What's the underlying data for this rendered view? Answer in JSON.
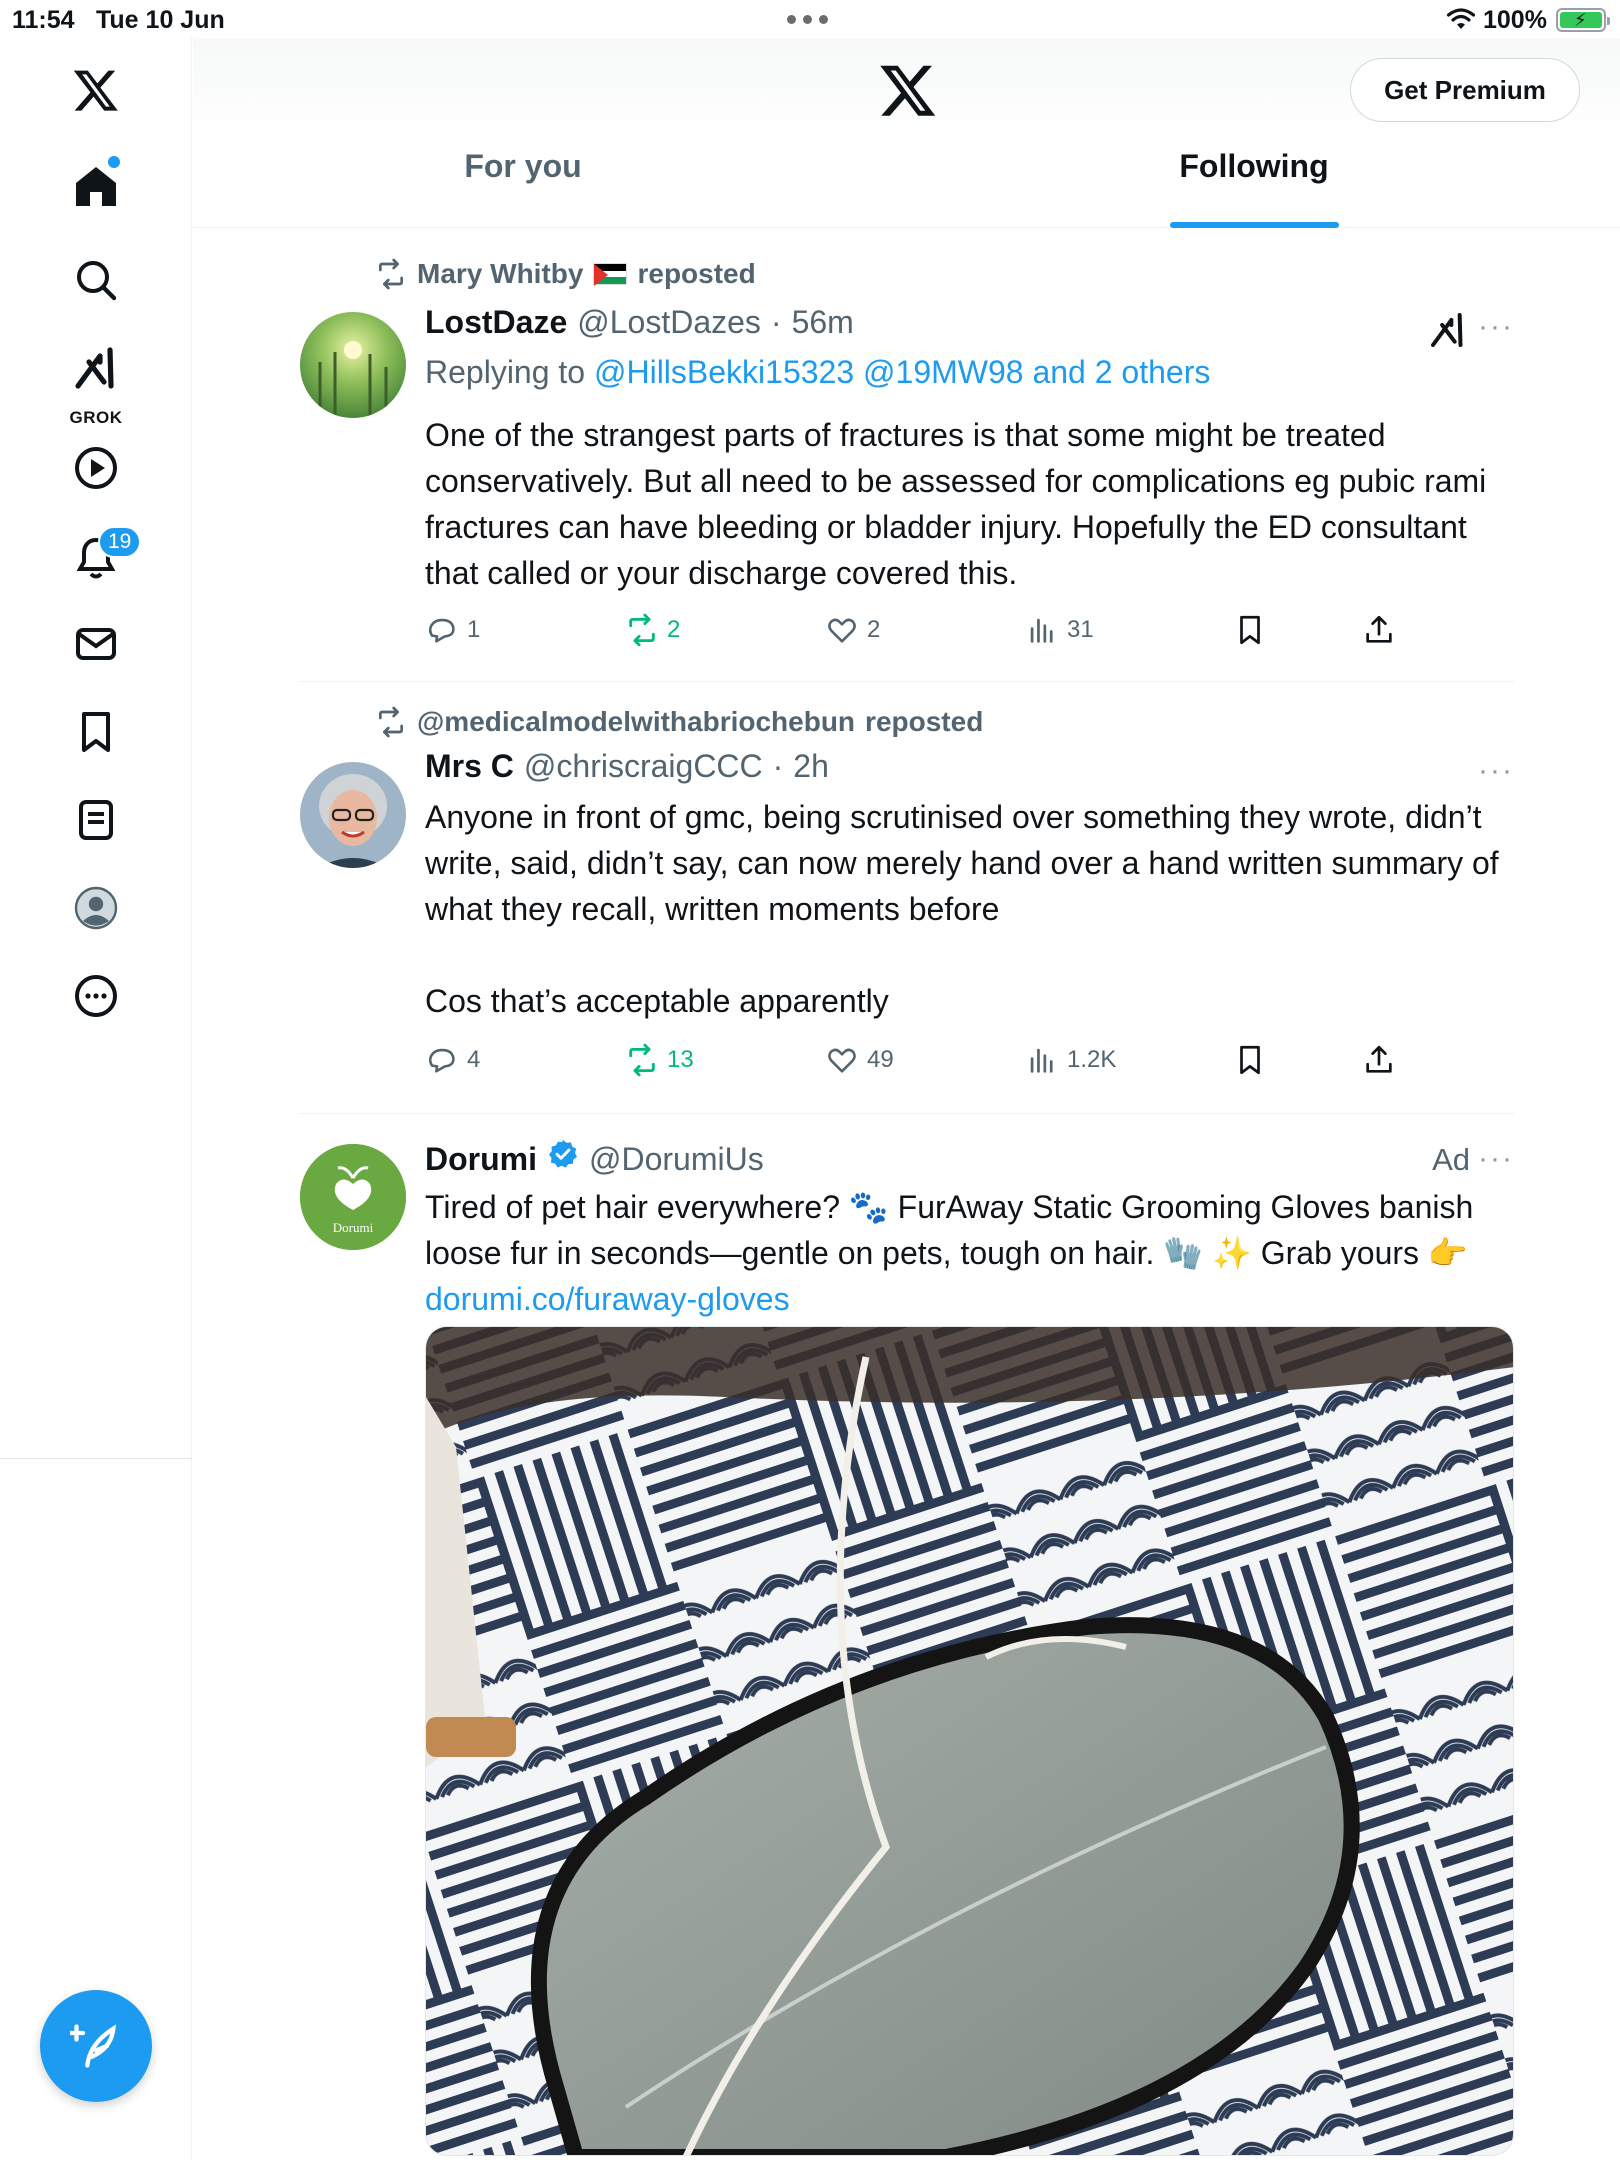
{
  "status_bar": {
    "time": "11:54",
    "date": "Tue 10 Jun",
    "battery": "100%"
  },
  "nav": {
    "items": [
      "home-icon",
      "search-icon",
      "grok-icon",
      "video-icon",
      "notifications-icon",
      "messages-icon",
      "bookmarks-icon",
      "lists-icon",
      "profile-icon",
      "more-icon"
    ],
    "grok_label": "GROK",
    "notification_count": "19"
  },
  "header": {
    "premium_label": "Get Premium",
    "tabs": [
      {
        "label": "For you",
        "active": false
      },
      {
        "label": "Following",
        "active": true
      }
    ]
  },
  "posts": [
    {
      "repost_by": "Mary Whitby",
      "repost_suffix": "reposted",
      "name": "LostDaze",
      "handle": "@LostDazes",
      "time": "56m",
      "reply_prefix": "Replying to",
      "reply_to": "@HillsBekki15323 @19MW98 and 2 others",
      "text": "One of the strangest parts of fractures is that some might be treated conservatively. But all need to be assessed for complications eg pubic rami fractures can have bleeding or bladder injury. Hopefully the ED consultant that called or your discharge covered this.",
      "stats": {
        "replies": "1",
        "reposts": "2",
        "likes": "2",
        "views": "31"
      }
    },
    {
      "repost_by": "@medicalmodelwithabriochebun",
      "repost_suffix": "reposted",
      "name": "Mrs C",
      "handle": "@chriscraigCCC",
      "time": "2h",
      "text_line1": "Anyone in front of gmc, being scrutinised over something they wrote, didn’t write, said, didn’t say, can now merely hand over a hand written summary of what they recall, written moments before",
      "text_line2": "Cos that’s acceptable apparently",
      "stats": {
        "replies": "4",
        "reposts": "13",
        "likes": "49",
        "views": "1.2K"
      }
    },
    {
      "name": "Dorumi",
      "handle": "@DorumiUs",
      "ad_label": "Ad",
      "avatar_text": "Dorumi",
      "text_a": "Tired of pet hair everywhere? 🐾 FurAway Static Grooming Gloves banish loose fur in seconds—gentle on pets, tough on hair. 🧤 ✨ Grab yours 👉 ",
      "link": "dorumi.co/furaway-gloves"
    }
  ],
  "colors": {
    "accent": "#1d9bf0",
    "repost_green": "#00ba7c",
    "secondary_text": "#536471"
  }
}
